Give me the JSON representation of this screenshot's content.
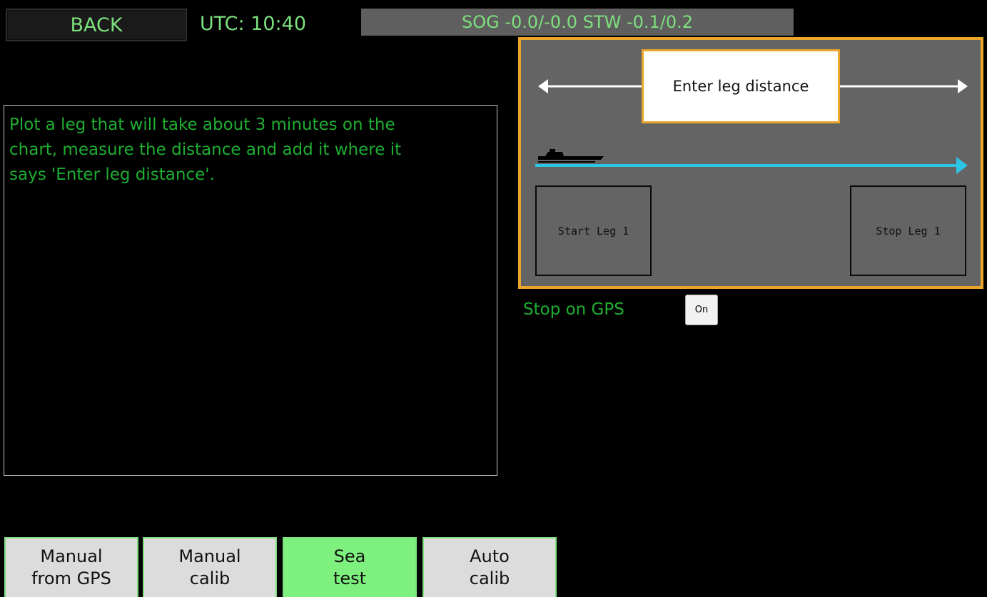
{
  "header": {
    "back_label": "BACK",
    "utc_label": "UTC: 10:40",
    "speed_readout": "SOG -0.0/-0.0 STW -0.1/0.2"
  },
  "instructions": {
    "text": "Plot a leg that will take about 3 minutes on the\nchart, measure the distance and add it  where it\nsays 'Enter leg distance'."
  },
  "leg_panel": {
    "distance_placeholder": "Enter leg distance",
    "start_label": "Start Leg 1",
    "stop_label": "Stop Leg 1",
    "boat_icon": "boat-icon",
    "colors": {
      "border": "#e9a62a",
      "track": "#2ec4e6",
      "panel": "#646464"
    }
  },
  "gps": {
    "label": "Stop on GPS",
    "toggle_value": "On"
  },
  "tabs": [
    {
      "line1": "Manual",
      "line2": "from GPS",
      "active": false
    },
    {
      "line1": "Manual",
      "line2": "calib",
      "active": false
    },
    {
      "line1": "Sea",
      "line2": "test",
      "active": true
    },
    {
      "line1": "Auto",
      "line2": "calib",
      "active": false
    }
  ],
  "colors": {
    "text_green": "#7de07d",
    "instr_green": "#1fae32",
    "active_tab": "#7ef07e"
  }
}
